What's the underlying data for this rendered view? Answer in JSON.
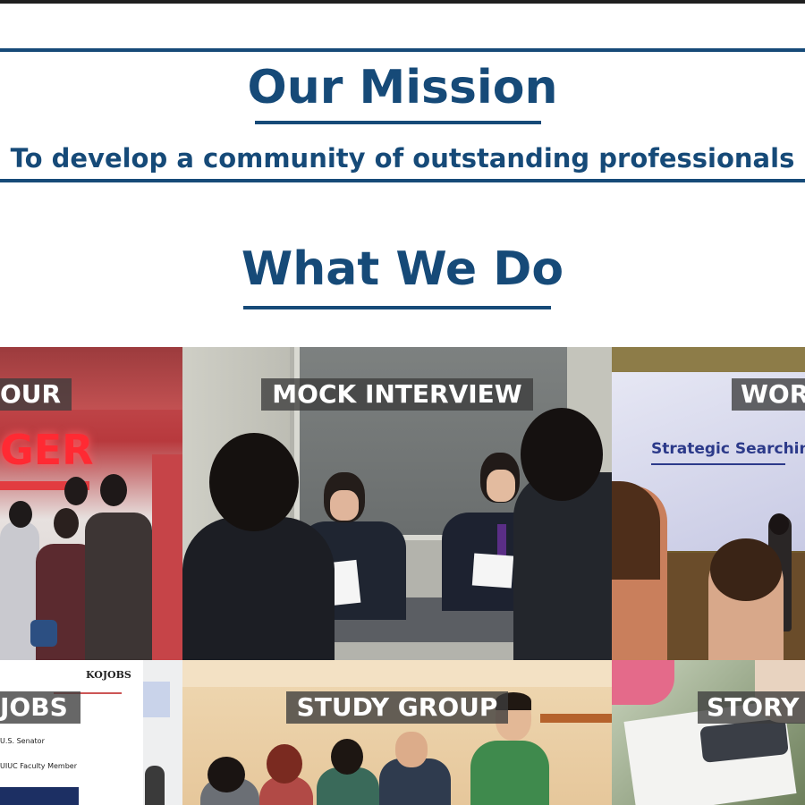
{
  "mission": {
    "title": "Our Mission",
    "tagline": "To develop a community of outstanding professionals"
  },
  "what_we_do": {
    "title": "What We Do",
    "tiles": [
      {
        "label": "OUR"
      },
      {
        "label": "MOCK INTERVIEW"
      },
      {
        "label": "WOR"
      },
      {
        "label": "JOBS"
      },
      {
        "label": "STUDY GROUP"
      },
      {
        "label": "STORY"
      }
    ]
  },
  "photo_text": {
    "sign": "GER",
    "slide_title": "Strategic Searching",
    "kojobs_logo": "KOJOBS",
    "doc_lines": [
      "U.S. Senator",
      "UIUC Faculty Member"
    ]
  },
  "colors": {
    "brand_blue": "#164a78",
    "label_background": "#3c3c3c"
  }
}
